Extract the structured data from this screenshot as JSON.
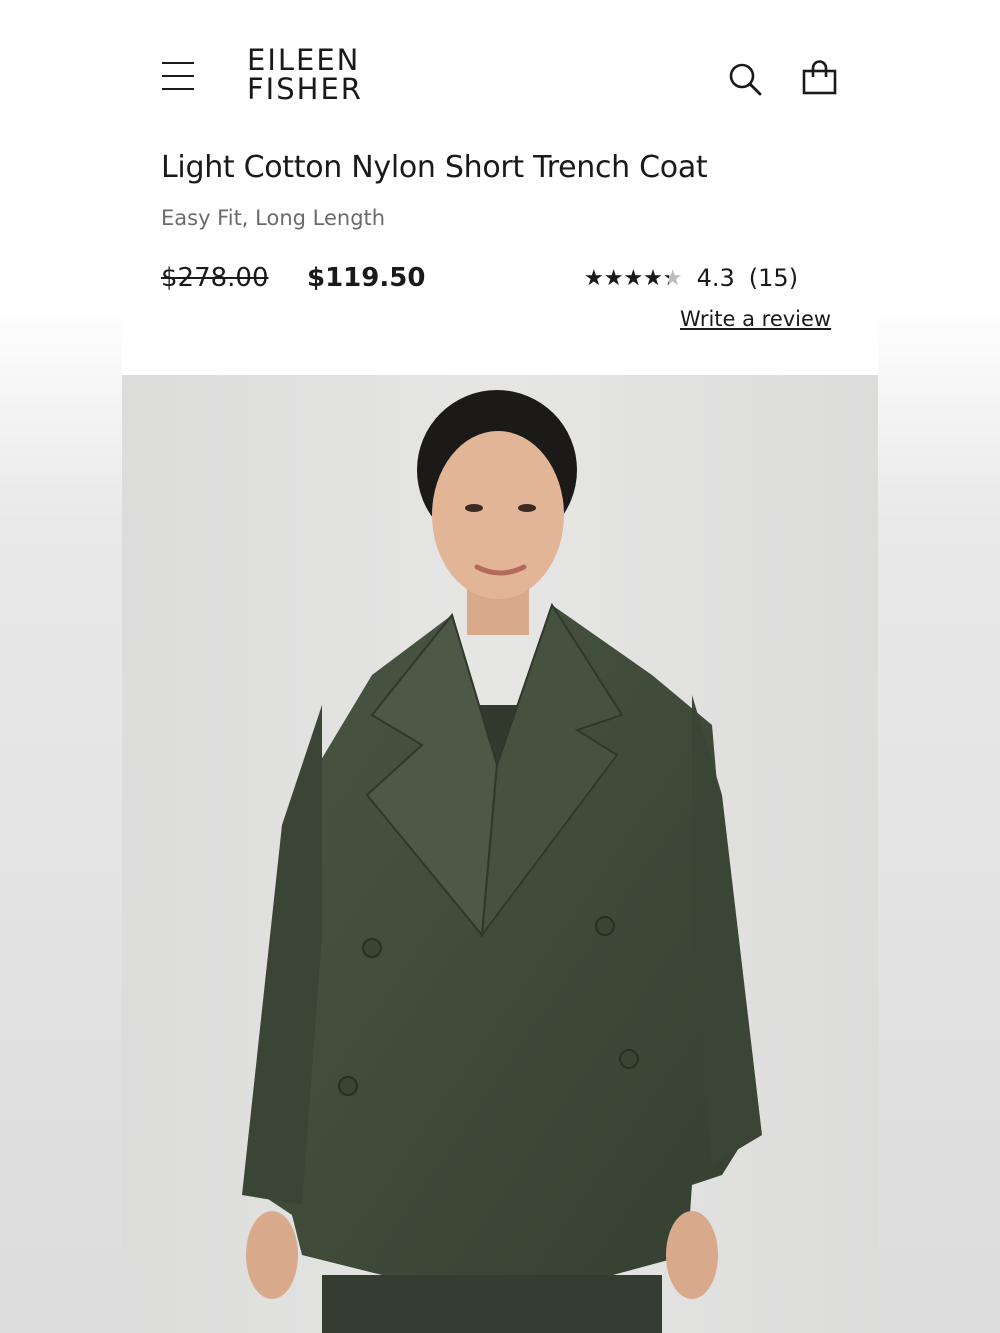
{
  "header": {
    "brand_line1": "EILEEN",
    "brand_line2": "FISHER",
    "menu_icon": "hamburger-menu-icon",
    "search_icon": "search-icon",
    "bag_icon": "shopping-bag-icon"
  },
  "product": {
    "title": "Light Cotton Nylon Short Trench Coat",
    "subtitle": "Easy Fit, Long Length",
    "original_price": "$278.00",
    "sale_price": "$119.50",
    "rating_value": "4.3",
    "rating_count": "(15)",
    "rating_fraction": 0.86,
    "stars_glyphs": "★★★★★",
    "write_review_label": "Write a review",
    "coat_color": "#3f4a39"
  }
}
